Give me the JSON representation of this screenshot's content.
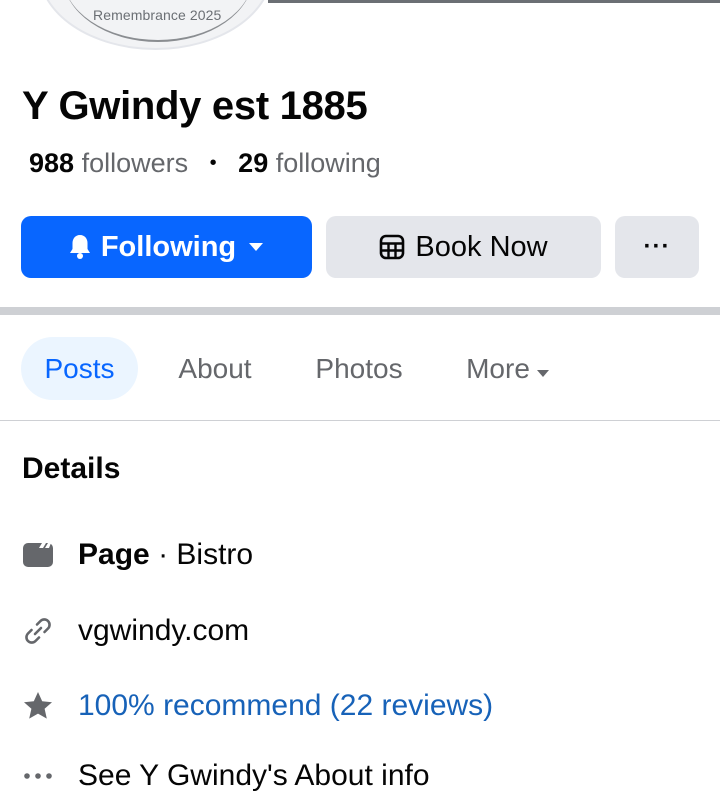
{
  "profile": {
    "picture_caption": "Remembrance 2025",
    "name": "Y Gwindy est 1885",
    "followers_count": "988",
    "followers_label": "followers",
    "following_count": "29",
    "following_label": "following"
  },
  "actions": {
    "following_label": "Following",
    "book_label": "Book Now",
    "more_label": "···"
  },
  "tabs": [
    {
      "label": "Posts",
      "selected": true
    },
    {
      "label": "About",
      "selected": false
    },
    {
      "label": "Photos",
      "selected": false
    },
    {
      "label": "More",
      "selected": false
    }
  ],
  "details": {
    "title": "Details",
    "page_label": "Page",
    "page_category": "· Bistro",
    "website": "vgwindy.com",
    "recommend": "100% recommend (22 reviews)",
    "about_link": "See Y Gwindy's About info"
  },
  "colors": {
    "accent": "#0866ff",
    "link": "#1762b8",
    "secondary_text": "#65676b",
    "button_gray": "#e4e6eb",
    "tab_selected_bg": "#ebf5ff"
  },
  "icons": {
    "following": "bell-icon",
    "dropdown": "caret-down-icon",
    "book": "calendar-grid-icon",
    "page": "page-flag-icon",
    "website": "link-icon",
    "recommend": "star-icon",
    "about": "more-dots-icon"
  }
}
